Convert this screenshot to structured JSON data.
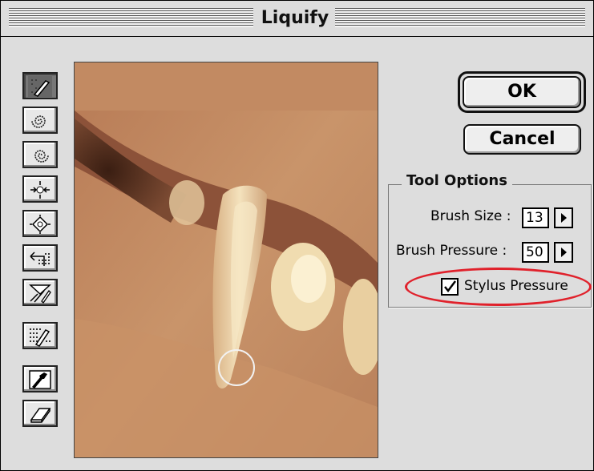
{
  "window": {
    "title": "Liquify"
  },
  "tools": [
    {
      "name": "warp-tool",
      "icon": "warp-icon",
      "selected": true
    },
    {
      "name": "twirl-clockwise-tool",
      "icon": "twirl-clockwise-icon",
      "selected": false
    },
    {
      "name": "twirl-counterclockwise-tool",
      "icon": "twirl-counterclockwise-icon",
      "selected": false
    },
    {
      "name": "pucker-tool",
      "icon": "pucker-icon",
      "selected": false
    },
    {
      "name": "bloat-tool",
      "icon": "bloat-icon",
      "selected": false
    },
    {
      "name": "shift-pixels-tool",
      "icon": "shift-pixels-icon",
      "selected": false
    },
    {
      "name": "reflection-tool",
      "icon": "reflection-icon",
      "selected": false
    },
    {
      "name": "freeze-tool",
      "icon": "freeze-icon",
      "selected": false
    },
    {
      "name": "reconstruct-tool",
      "icon": "reconstruct-icon",
      "selected": false
    },
    {
      "name": "eraser-tool",
      "icon": "eraser-icon",
      "selected": false
    }
  ],
  "buttons": {
    "ok": "OK",
    "cancel": "Cancel"
  },
  "tool_options": {
    "legend": "Tool Options",
    "brush_size_label": "Brush Size :",
    "brush_size_value": "13",
    "brush_pressure_label": "Brush Pressure :",
    "brush_pressure_value": "50",
    "stylus_pressure_label": "Stylus Pressure",
    "stylus_pressure_checked": true
  },
  "colors": {
    "window_bg": "#dddddd",
    "highlight": "#e0212b",
    "preview_skin": "#c58d5f",
    "preview_tooth": "#f0dcb0"
  }
}
